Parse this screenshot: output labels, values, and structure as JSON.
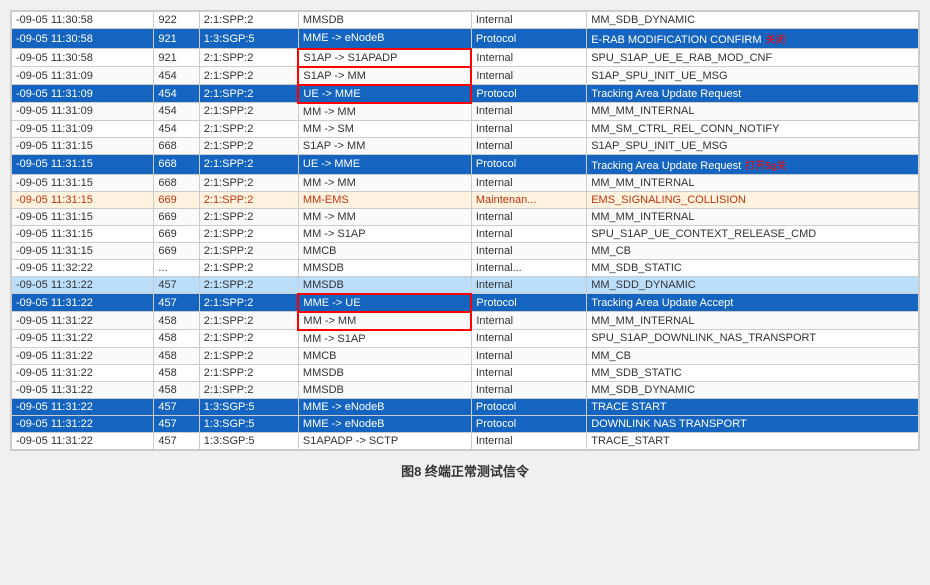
{
  "caption": "图8   终端正常测试信令",
  "annotations": {
    "close_switch_1": "关闭",
    "open_5g_1": "打开5g关",
    "open_switch": "打开5g关"
  },
  "rows": [
    {
      "time": "-09-05 11:30:58",
      "id": "922",
      "node": "2:1:SPP:2",
      "from": "MMSDB",
      "type": "Internal",
      "msg": "MM_SDB_DYNAMIC",
      "style": "normal"
    },
    {
      "time": "-09-05 11:30:58",
      "id": "921",
      "node": "1:3:SGP:5",
      "from": "MME -> eNodeB",
      "type": "Protocol",
      "msg": "E-RAB MODIFICATION CONFIRM",
      "style": "blue",
      "annotation": "关闭"
    },
    {
      "time": "-09-05 11:30:58",
      "id": "921",
      "node": "2:1:SPP:2",
      "from": "S1AP -> S1APADP",
      "type": "Internal",
      "msg": "SPU_S1AP_UE_E_RAB_MOD_CNF",
      "style": "normal",
      "boxed_col": "from"
    },
    {
      "time": "-09-05 11:31:09",
      "id": "454",
      "node": "2:1:SPP:2",
      "from": "S1AP -> MM",
      "type": "Internal",
      "msg": "S1AP_SPU_INIT_UE_MSG",
      "style": "normal",
      "boxed_col": "from"
    },
    {
      "time": "-09-05 11:31:09",
      "id": "454",
      "node": "2:1:SPP:2",
      "from": "UE -> MME",
      "type": "Protocol",
      "msg": "Tracking Area Update Request",
      "style": "blue",
      "boxed_col": "from"
    },
    {
      "time": "-09-05 11:31:09",
      "id": "454",
      "node": "2:1:SPP:2",
      "from": "MM -> MM",
      "type": "Internal",
      "msg": "MM_MM_INTERNAL",
      "style": "normal"
    },
    {
      "time": "-09-05 11:31:09",
      "id": "454",
      "node": "2:1:SPP:2",
      "from": "MM -> SM",
      "type": "Internal",
      "msg": "MM_SM_CTRL_REL_CONN_NOTIFY",
      "style": "normal"
    },
    {
      "time": "-09-05 11:31:15",
      "id": "668",
      "node": "2:1:SPP:2",
      "from": "S1AP -> MM",
      "type": "Internal",
      "msg": "S1AP_SPU_INIT_UE_MSG",
      "style": "normal"
    },
    {
      "time": "-09-05 11:31:15",
      "id": "668",
      "node": "2:1:SPP:2",
      "from": "UE -> MME",
      "type": "Protocol",
      "msg": "Tracking Area Update Request",
      "style": "blue",
      "annotation": "打开5g关"
    },
    {
      "time": "-09-05 11:31:15",
      "id": "668",
      "node": "2:1:SPP:2",
      "from": "MM -> MM",
      "type": "Internal",
      "msg": "MM_MM_INTERNAL",
      "style": "normal"
    },
    {
      "time": "-09-05 11:31:15",
      "id": "669",
      "node": "2:1:SPP:2",
      "from": "MM-EMS",
      "type": "Maintenan...",
      "msg": "EMS_SIGNALING_COLLISION",
      "style": "orange"
    },
    {
      "time": "-09-05 11:31:15",
      "id": "669",
      "node": "2:1:SPP:2",
      "from": "MM -> MM",
      "type": "Internal",
      "msg": "MM_MM_INTERNAL",
      "style": "normal"
    },
    {
      "time": "-09-05 11:31:15",
      "id": "669",
      "node": "2:1:SPP:2",
      "from": "MM -> S1AP",
      "type": "Internal",
      "msg": "SPU_S1AP_UE_CONTEXT_RELEASE_CMD",
      "style": "normal"
    },
    {
      "time": "-09-05 11:31:15",
      "id": "669",
      "node": "2:1:SPP:2",
      "from": "MMCB",
      "type": "Internal",
      "msg": "MM_CB",
      "style": "normal"
    },
    {
      "time": "-09-05 11:32:22",
      "id": "...",
      "node": "2:1:SPP:2",
      "from": "MMSDB",
      "type": "Internal...",
      "msg": "MM_SDB_STATIC",
      "style": "normal"
    },
    {
      "time": "-09-05 11:31:22",
      "id": "457",
      "node": "2:1:SPP:2",
      "from": "MMSDB",
      "type": "Internal",
      "msg": "MM_SDD_DYNAMIC",
      "style": "blue-partial"
    },
    {
      "time": "-09-05 11:31:22",
      "id": "457",
      "node": "2:1:SPP:2",
      "from": "MME -> UE",
      "type": "Protocol",
      "msg": "Tracking Area Update Accept",
      "style": "blue",
      "boxed_col": "from"
    },
    {
      "time": "-09-05 11:31:22",
      "id": "458",
      "node": "2:1:SPP:2",
      "from": "MM -> MM",
      "type": "Internal",
      "msg": "MM_MM_INTERNAL",
      "style": "normal",
      "boxed_col": "from"
    },
    {
      "time": "-09-05 11:31:22",
      "id": "458",
      "node": "2:1:SPP:2",
      "from": "MM -> S1AP",
      "type": "Internal",
      "msg": "SPU_S1AP_DOWNLINK_NAS_TRANSPORT",
      "style": "normal"
    },
    {
      "time": "-09-05 11:31:22",
      "id": "458",
      "node": "2:1:SPP:2",
      "from": "MMCB",
      "type": "Internal",
      "msg": "MM_CB",
      "style": "normal"
    },
    {
      "time": "-09-05 11:31:22",
      "id": "458",
      "node": "2:1:SPP:2",
      "from": "MMSDB",
      "type": "Internal",
      "msg": "MM_SDB_STATIC",
      "style": "normal"
    },
    {
      "time": "-09-05 11:31:22",
      "id": "458",
      "node": "2:1:SPP:2",
      "from": "MMSDB",
      "type": "Internal",
      "msg": "MM_SDB_DYNAMIC",
      "style": "normal"
    },
    {
      "time": "-09-05 11:31:22",
      "id": "457",
      "node": "1:3:SGP:5",
      "from": "MME -> eNodeB",
      "type": "Protocol",
      "msg": "TRACE START",
      "style": "blue"
    },
    {
      "time": "-09-05 11:31:22",
      "id": "457",
      "node": "1:3:SGP:5",
      "from": "MME -> eNodeB",
      "type": "Protocol",
      "msg": "DOWNLINK NAS TRANSPORT",
      "style": "blue"
    },
    {
      "time": "-09-05 11:31:22",
      "id": "457",
      "node": "1:3:SGP:5",
      "from": "S1APADP -> SCTP",
      "type": "Internal",
      "msg": "TRACE_START",
      "style": "normal"
    }
  ]
}
